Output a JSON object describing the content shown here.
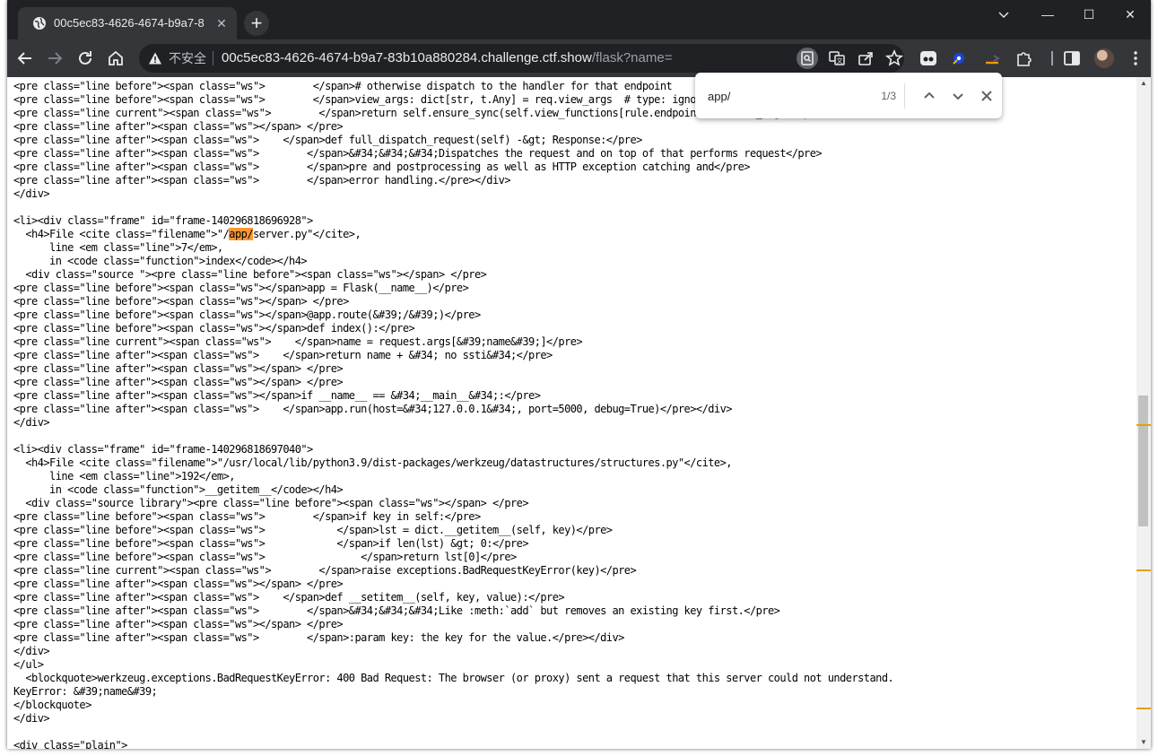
{
  "browser": {
    "tab_title": "00c5ec83-4626-4674-b9a7-8",
    "new_tab_symbol": "+",
    "window_controls": {
      "minimize": "—",
      "maximize": "☐",
      "close": "✕"
    },
    "security_label": "不安全",
    "url_host": "00c5ec83-4626-4674-b9a7-83b10a880284.challenge.ctf.show",
    "url_path": "/flask?name="
  },
  "find": {
    "query": "app/",
    "count": "1/3"
  },
  "source": {
    "lines_before_highlight": "<pre class=\"line before\"><span class=\"ws\">        </span># otherwise dispatch to the handler for that endpoint\n<pre class=\"line before\"><span class=\"ws\">        </span>view_args: dict[str, t.Any] = req.view_args  # type: ignore\n<pre class=\"line current\"><span class=\"ws\">        </span>return self.ensure_sync(self.view_functions[rule.endpoint])(**view_args)</pre>\n<pre class=\"line after\"><span class=\"ws\"></span> </pre>\n<pre class=\"line after\"><span class=\"ws\">    </span>def full_dispatch_request(self) -&gt; Response:</pre>\n<pre class=\"line after\"><span class=\"ws\">        </span>&#34;&#34;&#34;Dispatches the request and on top of that performs request</pre>\n<pre class=\"line after\"><span class=\"ws\">        </span>pre and postprocessing as well as HTTP exception catching and</pre>\n<pre class=\"line after\"><span class=\"ws\">        </span>error handling.</pre></div>\n</div>\n\n<li><div class=\"frame\" id=\"frame-140296818696928\">\n  <h4>File <cite class=\"filename\">\"/",
    "highlight": "app/",
    "lines_after_highlight": "server.py\"</cite>,\n      line <em class=\"line\">7</em>,\n      in <code class=\"function\">index</code></h4>\n  <div class=\"source \"><pre class=\"line before\"><span class=\"ws\"></span> </pre>\n<pre class=\"line before\"><span class=\"ws\"></span>app = Flask(__name__)</pre>\n<pre class=\"line before\"><span class=\"ws\"></span> </pre>\n<pre class=\"line before\"><span class=\"ws\"></span>@app.route(&#39;/&#39;)</pre>\n<pre class=\"line before\"><span class=\"ws\"></span>def index():</pre>\n<pre class=\"line current\"><span class=\"ws\">    </span>name = request.args[&#39;name&#39;]</pre>\n<pre class=\"line after\"><span class=\"ws\">    </span>return name + &#34; no ssti&#34;</pre>\n<pre class=\"line after\"><span class=\"ws\"></span> </pre>\n<pre class=\"line after\"><span class=\"ws\"></span> </pre>\n<pre class=\"line after\"><span class=\"ws\"></span>if __name__ == &#34;__main__&#34;:</pre>\n<pre class=\"line after\"><span class=\"ws\">    </span>app.run(host=&#34;127.0.0.1&#34;, port=5000, debug=True)</pre></div>\n</div>\n\n<li><div class=\"frame\" id=\"frame-140296818697040\">\n  <h4>File <cite class=\"filename\">\"/usr/local/lib/python3.9/dist-packages/werkzeug/datastructures/structures.py\"</cite>,\n      line <em class=\"line\">192</em>,\n      in <code class=\"function\">__getitem__</code></h4>\n  <div class=\"source library\"><pre class=\"line before\"><span class=\"ws\"></span> </pre>\n<pre class=\"line before\"><span class=\"ws\">        </span>if key in self:</pre>\n<pre class=\"line before\"><span class=\"ws\">            </span>lst = dict.__getitem__(self, key)</pre>\n<pre class=\"line before\"><span class=\"ws\">            </span>if len(lst) &gt; 0:</pre>\n<pre class=\"line before\"><span class=\"ws\">                </span>return lst[0]</pre>\n<pre class=\"line current\"><span class=\"ws\">        </span>raise exceptions.BadRequestKeyError(key)</pre>\n<pre class=\"line after\"><span class=\"ws\"></span> </pre>\n<pre class=\"line after\"><span class=\"ws\">    </span>def __setitem__(self, key, value):</pre>\n<pre class=\"line after\"><span class=\"ws\">        </span>&#34;&#34;&#34;Like :meth:`add` but removes an existing key first.</pre>\n<pre class=\"line after\"><span class=\"ws\"></span> </pre>\n<pre class=\"line after\"><span class=\"ws\">        </span>:param key: the key for the value.</pre></div>\n</div>\n</ul>\n  <blockquote>werkzeug.exceptions.BadRequestKeyError: 400 Bad Request: The browser (or proxy) sent a request that this server could not understand.\nKeyError: &#39;name&#39;\n</blockquote>\n</div>\n\n<div class=\"plain\">"
  },
  "colors": {
    "frame_dark": "#202124",
    "toolbar": "#35363a",
    "find_highlight": "#ff9632",
    "scroll_mark": "#e8a100"
  }
}
